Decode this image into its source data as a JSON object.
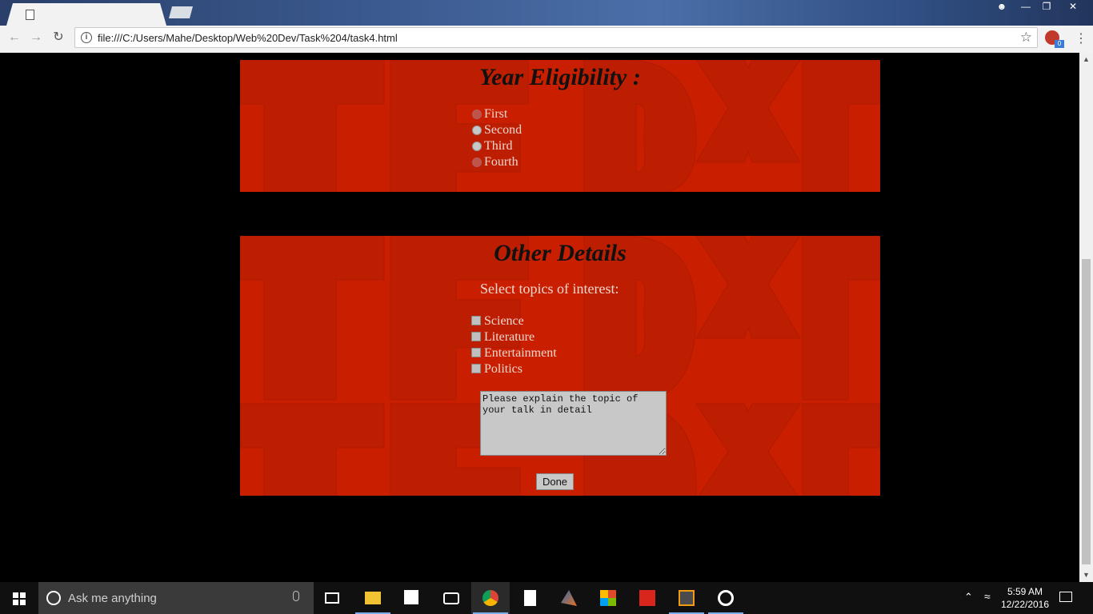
{
  "browser": {
    "url": "file:///C:/Users/Mahe/Desktop/Web%20Dev/Task%204/task4.html",
    "extension_badge": "0"
  },
  "year_section": {
    "title": "Year Eligibility :",
    "options": [
      "First",
      "Second",
      "Third",
      "Fourth"
    ]
  },
  "details_section": {
    "title": "Other Details",
    "topics_label": "Select topics of interest:",
    "topics": [
      "Science",
      "Literature",
      "Entertainment",
      "Politics"
    ],
    "textarea_value": "Please explain the topic of your talk in detail",
    "done_label": "Done"
  },
  "taskbar": {
    "search_placeholder": "Ask me anything",
    "time": "5:59 AM",
    "date": "12/22/2016"
  },
  "colors": {
    "panel_red": "#c91f00",
    "page_bg": "#000000"
  }
}
